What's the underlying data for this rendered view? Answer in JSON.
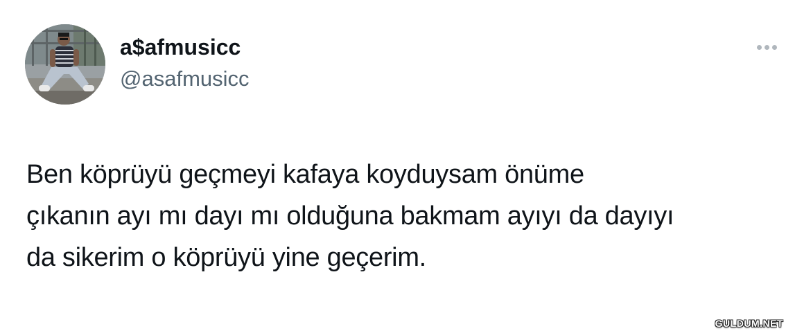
{
  "author": {
    "display_name": "a$afmusicc",
    "handle": "@asafmusicc",
    "avatar_icon": "profile-photo"
  },
  "more_options_icon": "more-horizontal-icon",
  "tweet": {
    "lines": [
      "Ben köprüyü geçmeyi kafaya koyduysam önüme",
      "çıkanın ayı mı dayı mı olduğuna bakmam ayıyı da dayıyı",
      "da sikerim o köprüyü yine geçerim."
    ]
  },
  "watermark": "GULDUM.NET",
  "colors": {
    "text": "#0f1419",
    "handle": "#536471",
    "more_dots": "#b0b7bd",
    "background": "#ffffff"
  }
}
